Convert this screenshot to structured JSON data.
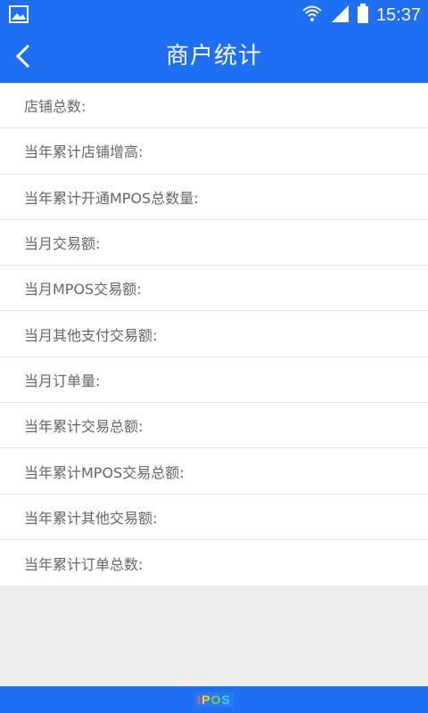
{
  "status_bar": {
    "time": "15:37",
    "icons": [
      "gallery-notification-icon",
      "wifi-icon",
      "signal-icon",
      "battery-icon"
    ]
  },
  "header": {
    "title": "商户统计",
    "back_icon": "chevron-left-icon"
  },
  "stats": [
    {
      "label": "店铺总数:"
    },
    {
      "label": "当年累计店铺增高:"
    },
    {
      "label": "当年累计开通MPOS总数量:"
    },
    {
      "label": "当月交易额:"
    },
    {
      "label": "当月MPOS交易额:"
    },
    {
      "label": "当月其他支付交易额:"
    },
    {
      "label": "当月订单量:"
    },
    {
      "label": "当年累计交易总额:"
    },
    {
      "label": "当年累计MPOS交易总额:"
    },
    {
      "label": "当年累计其他交易额:"
    },
    {
      "label": "当年累计订单总数:"
    }
  ],
  "footer": {
    "logo_text": "IPOS"
  },
  "colors": {
    "primary": "#1e6ff3",
    "row_text": "#666666",
    "background": "#efefef"
  }
}
